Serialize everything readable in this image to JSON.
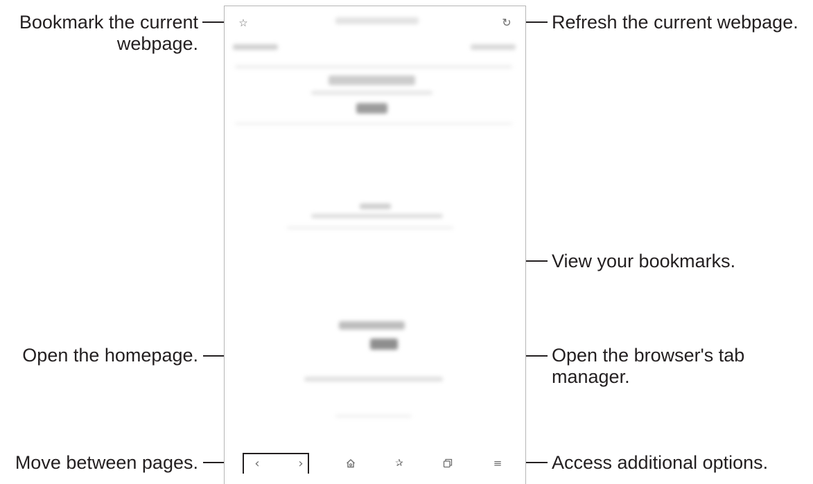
{
  "callouts": {
    "bookmark_line1": "Bookmark the current",
    "bookmark_line2": "webpage.",
    "refresh": "Refresh the current webpage.",
    "view_bookmarks": "View your bookmarks.",
    "open_homepage": "Open the homepage.",
    "tab_manager_line1": "Open the browser's tab",
    "tab_manager_line2": "manager.",
    "move_pages": "Move between pages.",
    "additional_options": "Access additional options."
  },
  "icons": {
    "top_left": "star-outline-icon",
    "top_right": "refresh-icon",
    "back": "chevron-left-icon",
    "forward": "chevron-right-icon",
    "home": "home-icon",
    "bookmarks": "bookmarks-star-icon",
    "tabs": "tabs-icon",
    "menu": "menu-icon"
  },
  "colors": {
    "text": "#231f20",
    "device_border": "#b5b5b5",
    "icon": "#6d6d6d",
    "blurred_content": "#d9d9d9"
  }
}
